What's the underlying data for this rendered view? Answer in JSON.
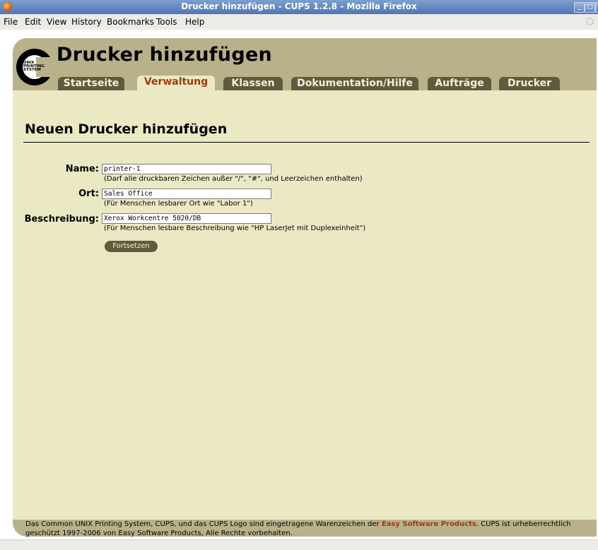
{
  "window": {
    "title": "Drucker hinzufügen - CUPS 1.2.8 - Mozilla Firefox"
  },
  "menu": [
    "File",
    "Edit",
    "View",
    "History",
    "Bookmarks",
    "Tools",
    "Help"
  ],
  "logo": {
    "line1": "UNIX",
    "line2": "PRINTING",
    "line3": "SYSTEM"
  },
  "page": {
    "title": "Drucker hinzufügen"
  },
  "tabs": [
    {
      "label": "Startseite"
    },
    {
      "label": "Verwaltung",
      "active": true
    },
    {
      "label": "Klassen"
    },
    {
      "label": "Dokumentation/Hilfe"
    },
    {
      "label": "Aufträge"
    },
    {
      "label": "Drucker"
    }
  ],
  "form": {
    "heading": "Neuen Drucker hinzufügen",
    "name_label": "Name:",
    "name_value": "printer-1",
    "name_hint": "(Darf alle druckbaren Zeichen außer \"/\", \"#\", und Leerzeichen enthalten)",
    "location_label": "Ort:",
    "location_value": "Sales Office",
    "location_hint": "(Für Menschen lesbarer Ort wie \"Labor 1\")",
    "description_label": "Beschreibung:",
    "description_value": "Xerox Workcentre 5020/DB",
    "description_hint": "(Für Menschen lesbare Beschreibung wie \"HP LaserJet mit Duplexeinheit\")",
    "continue_label": "Fortsetzen"
  },
  "footer": {
    "text_before": "Das Common UNIX Printing System, CUPS, und das CUPS Logo sind eingetragene Warenzeichen der ",
    "company": "Easy Software Products",
    "text_after": ". CUPS ist urheberrechtlich geschützt 1997-2006 von Easy Software Products, Alle Rechte vorbehalten."
  },
  "colors": {
    "frame": "#b9b18a",
    "content": "#ebe9c4",
    "tab": "#5f5b3d",
    "accent": "#a03a10"
  }
}
